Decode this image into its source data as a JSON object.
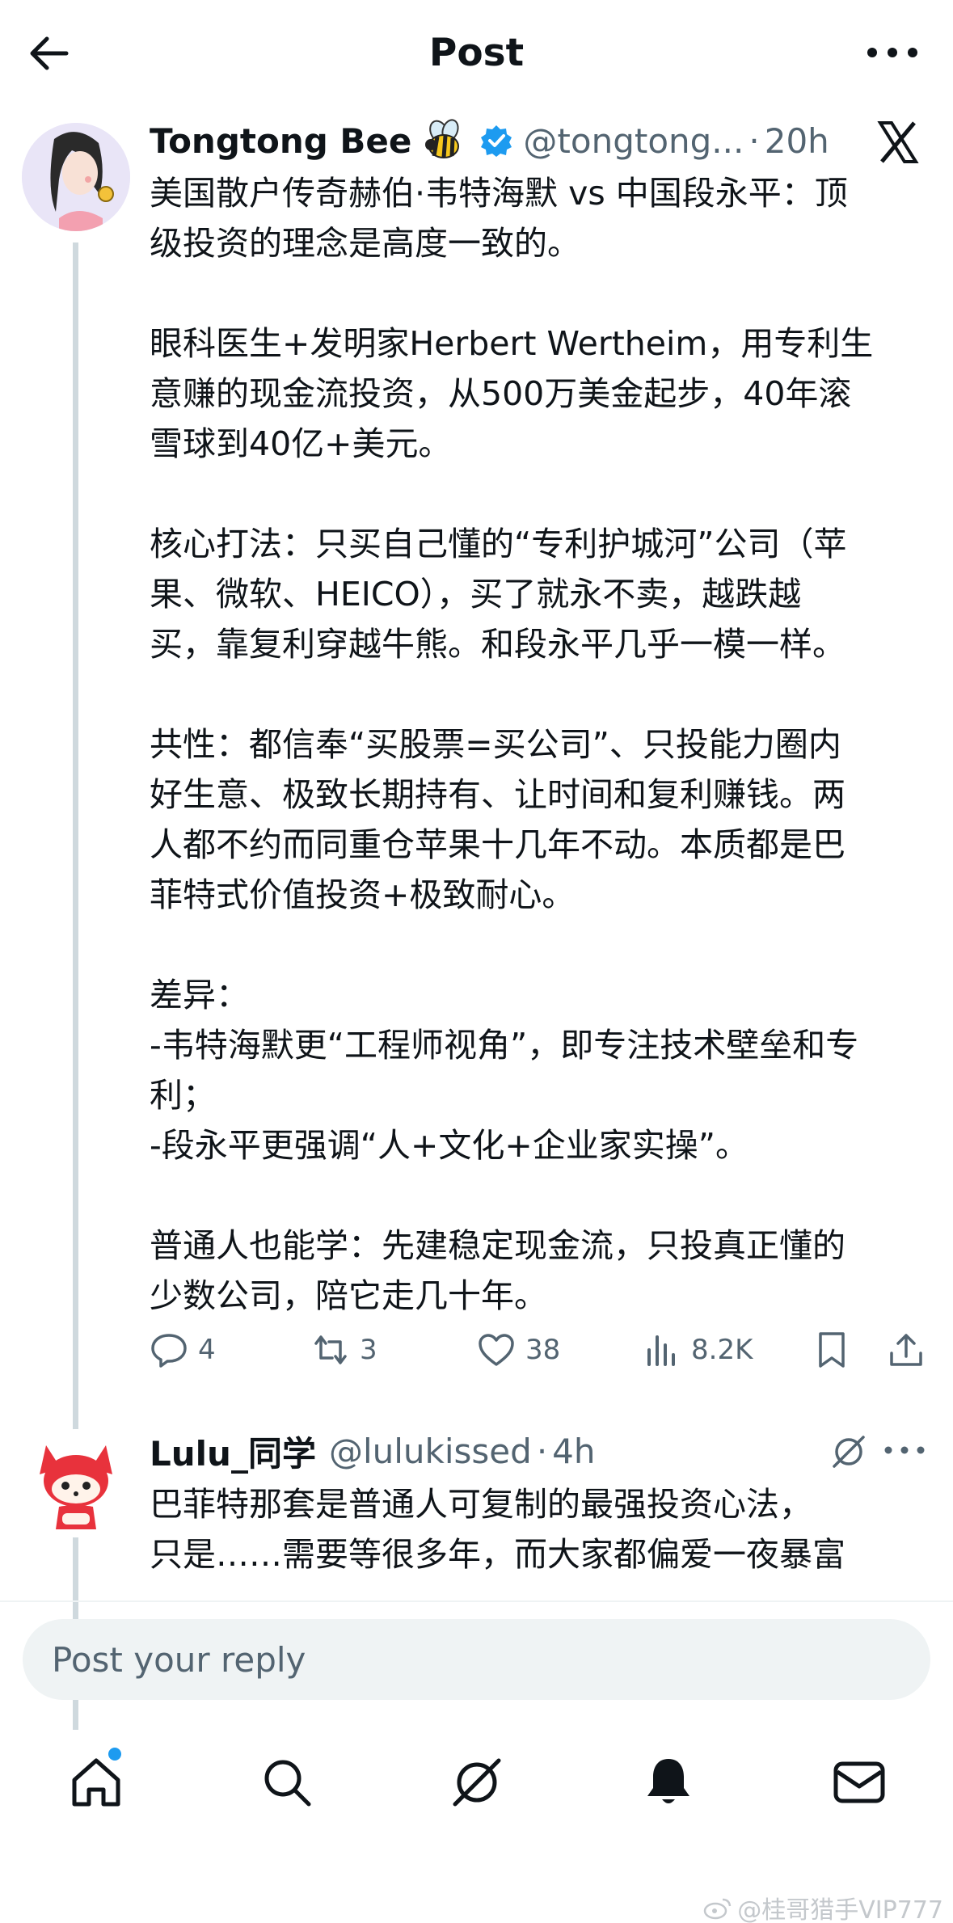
{
  "header": {
    "title": "Post"
  },
  "post": {
    "author_name": "Tongtong Bee",
    "handle": "@tongtong...",
    "separator": "·",
    "time": "20h",
    "paragraphs": [
      "美国散户传奇赫伯·韦特海默 vs 中国段永平：顶\n级投资的理念是高度一致的。",
      "眼科医生+发明家Herbert Wertheim，用专利生\n意赚的现金流投资，从500万美金起步，40年滚\n雪球到40亿+美元。",
      "核心打法：只买自己懂的“专利护城河”公司（苹\n果、微软、HEICO），买了就永不卖，越跌越\n买，靠复利穿越牛熊。和段永平几乎一模一样。",
      "共性：都信奉“买股票=买公司”、只投能力圈内\n好生意、极致长期持有、让时间和复利赚钱。两\n人都不约而同重仓苹果十几年不动。本质都是巴\n菲特式价值投资+极致耐心。",
      "差异：\n-韦特海默更“工程师视角”，即专注技术壁垒和专\n利；\n-段永平更强调“人+文化+企业家实操”。",
      "普通人也能学：先建稳定现金流，只投真正懂的\n少数公司，陪它走几十年。"
    ],
    "actions": {
      "replies": "4",
      "reposts": "3",
      "likes": "38",
      "views": "8.2K"
    }
  },
  "reply": {
    "author_name": "Lulu_同学",
    "handle": "@lulukissed",
    "separator": "·",
    "time": "4h",
    "text": "巴菲特那套是普通人可复制的最强投资心法，\n只是……需要等很多年，而大家都偏爱一夜暴富"
  },
  "composer": {
    "placeholder": "Post your reply"
  },
  "watermark": {
    "text": "@桂哥猎手VIP777"
  },
  "colors": {
    "text_primary": "#0f1419",
    "text_secondary": "#536471",
    "verified_blue": "#1d9bf0",
    "thread_line": "#cfd9de",
    "composer_bg": "#eff3f4"
  }
}
